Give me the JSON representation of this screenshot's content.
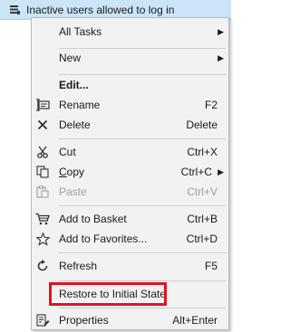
{
  "header": {
    "title": "Inactive users allowed to log in",
    "icon": "server-list-icon"
  },
  "menu": {
    "all_tasks": "All Tasks",
    "new": "New",
    "edit": "Edit...",
    "rename": {
      "label": "Rename",
      "shortcut": "F2",
      "icon": "rename-icon"
    },
    "delete": {
      "label": "Delete",
      "shortcut": "Delete",
      "icon": "delete-x-icon"
    },
    "cut": {
      "label": "Cut",
      "shortcut": "Ctrl+X",
      "icon": "scissors-icon"
    },
    "copy": {
      "label_first": "C",
      "label_rest": "opy",
      "shortcut": "Ctrl+C",
      "icon": "copy-icon"
    },
    "paste": {
      "label": "Paste",
      "shortcut": "Ctrl+V",
      "icon": "paste-icon"
    },
    "add_basket": {
      "label": "Add to Basket",
      "shortcut": "Ctrl+B",
      "icon": "basket-icon"
    },
    "add_favorites": {
      "label": "Add to Favorites...",
      "shortcut": "Ctrl+D",
      "icon": "star-icon"
    },
    "refresh": {
      "label": "Refresh",
      "shortcut": "F5",
      "icon": "refresh-icon"
    },
    "restore": {
      "label": "Restore to Initial State"
    },
    "properties": {
      "label": "Properties",
      "shortcut": "Alt+Enter",
      "icon": "properties-icon"
    }
  },
  "colors": {
    "header_bg": "#cce4f7",
    "menu_bg": "#f2f2f2",
    "highlight_border": "#e0131f",
    "disabled_text": "#a0a0a0"
  }
}
